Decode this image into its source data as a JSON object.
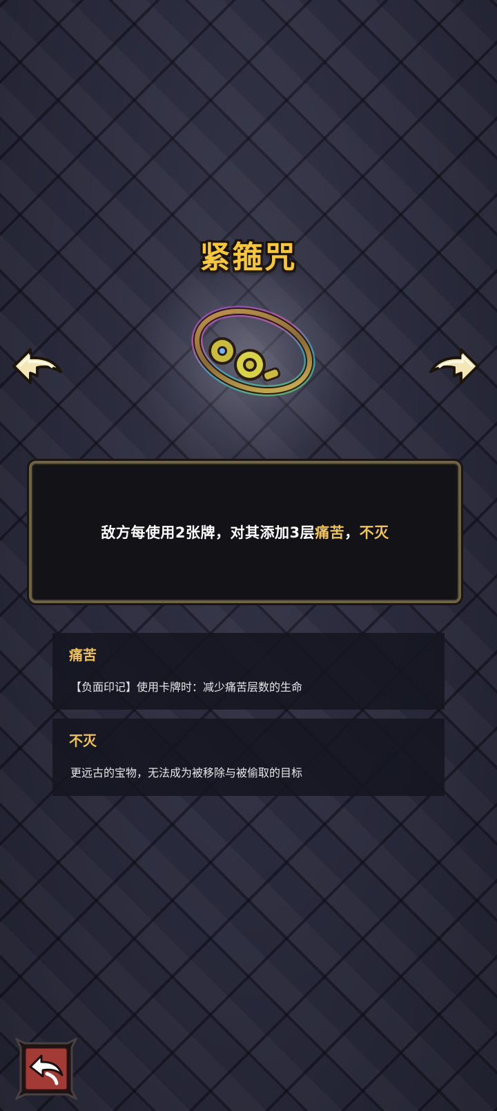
{
  "relic": {
    "name": "紧箍咒",
    "icon": "golden-headband-icon",
    "description": {
      "part1": "敌方每使用2张牌，对其添加3层",
      "keyword1": "痛苦",
      "sep": "，",
      "keyword2": "不灭"
    }
  },
  "keywords": [
    {
      "title": "痛苦",
      "description": "【负面印记】使用卡牌时：减少痛苦层数的生命"
    },
    {
      "title": "不灭",
      "description": "更远古的宝物，无法成为被移除与被偷取的目标"
    }
  ],
  "navigation": {
    "prev_icon": "arrow-left-icon",
    "next_icon": "arrow-right-icon",
    "back_icon": "return-icon"
  },
  "colors": {
    "title": "#f6c63d",
    "keyword": "#f1c45a",
    "panel_border": "#6e6247",
    "back_button": "#a23a36"
  }
}
